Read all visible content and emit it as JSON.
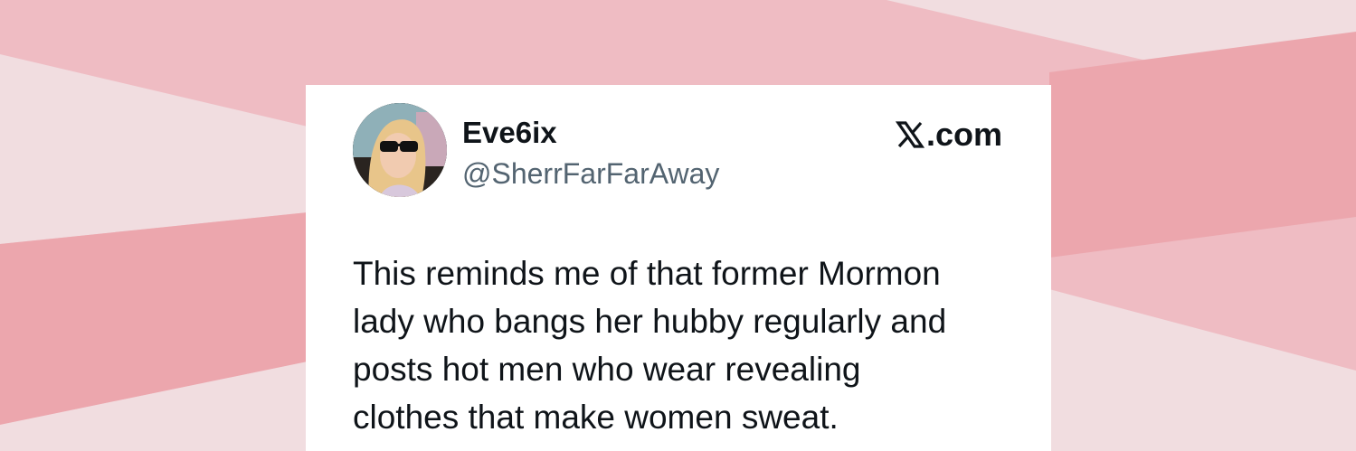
{
  "background": {
    "base_color": "#efbcc3",
    "light_band_color": "#f1dde0",
    "dark_band_color": "#eca6ad"
  },
  "tweet": {
    "display_name": "Eve6ix",
    "handle": "@SherrFarFarAway",
    "brand": {
      "icon": "x-logo-icon",
      "suffix": ".com"
    },
    "avatar_icon": "profile-photo-avatar",
    "text_lines": [
      "This reminds me of that former Mormon",
      "lady who bangs her hubby regularly and",
      "posts hot men who wear revealing",
      "clothes that make women sweat."
    ]
  }
}
